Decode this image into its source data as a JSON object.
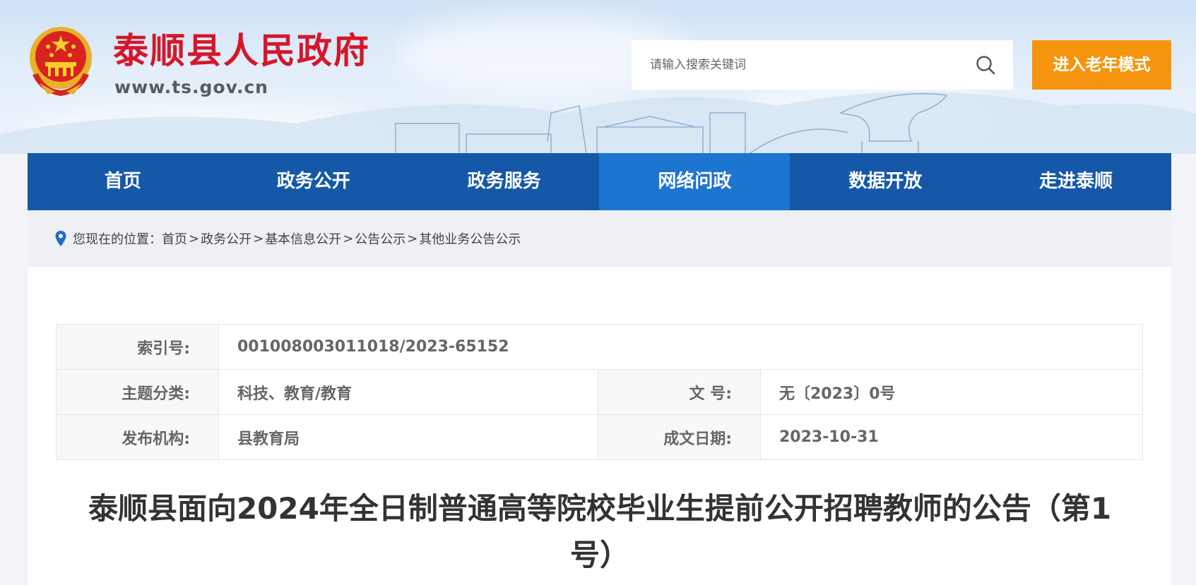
{
  "header": {
    "site_title": "泰顺县人民政府",
    "site_url": "www.ts.gov.cn",
    "search_placeholder": "请输入搜索关键词",
    "elder_mode_label": "进入老年模式"
  },
  "nav": {
    "items": [
      {
        "label": "首页",
        "active": false
      },
      {
        "label": "政务公开",
        "active": false
      },
      {
        "label": "政务服务",
        "active": false
      },
      {
        "label": "网络问政",
        "active": true
      },
      {
        "label": "数据开放",
        "active": false
      },
      {
        "label": "走进泰顺",
        "active": false
      }
    ]
  },
  "breadcrumb": {
    "prefix": "您现在的位置：",
    "items": [
      "首页",
      "政务公开",
      "基本信息公开",
      "公告公示",
      "其他业务公告公示"
    ],
    "separator": ">"
  },
  "meta": {
    "index_label": "索引号:",
    "index_value": "001008003011018/2023-65152",
    "topic_label": "主题分类:",
    "topic_value": "科技、教育/教育",
    "docno_label": "文 号:",
    "docno_value": "无〔2023〕0号",
    "publisher_label": "发布机构:",
    "publisher_value": "县教育局",
    "date_label": "成文日期:",
    "date_value": "2023-10-31"
  },
  "article": {
    "title": "泰顺县面向2024年全日制普通高等院校毕业生提前公开招聘教师的公告（第1号）"
  },
  "colors": {
    "title_red": "#d5172a",
    "nav_blue": "#1558a8",
    "nav_active": "#1d75cf",
    "elder_orange": "#f5950e"
  }
}
